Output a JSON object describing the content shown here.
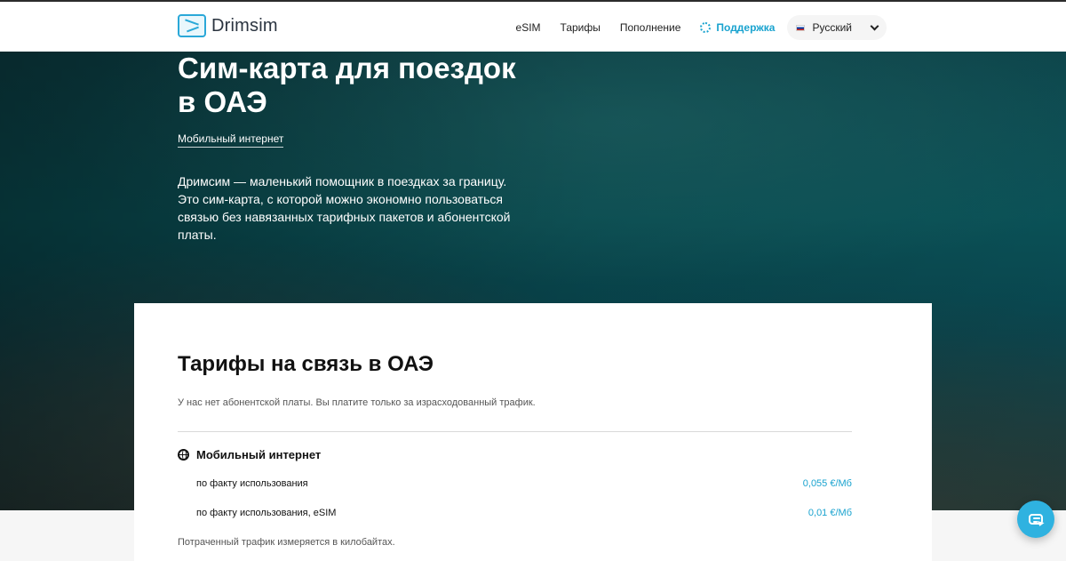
{
  "header": {
    "logo_text": "Drimsim",
    "nav": {
      "esim": "eSIM",
      "tariffs": "Тарифы",
      "topup": "Пополнение",
      "support": "Поддержка"
    },
    "language": {
      "label": "Русский"
    }
  },
  "hero": {
    "title_line1": "Сим-карта для поездок",
    "title_line2": "в ОАЭ",
    "link": "Мобильный интернет",
    "description": "Дримсим — маленький помощник в поездках за границу. Это сим-карта, с которой можно экономно пользоваться связью без навязанных тарифных пакетов и абонентской платы."
  },
  "rates": {
    "title": "Тарифы на связь в ОАЭ",
    "subtitle": "У нас нет абонентской платы. Вы платите только за израсходованный трафик.",
    "section_title": "Мобильный интернет",
    "rows": [
      {
        "label": "по факту использования",
        "price": "0,055 €/Мб"
      },
      {
        "label": "по факту использования, eSIM",
        "price": "0,01 €/Мб"
      }
    ],
    "footnote": "Потраченный трафик измеряется в килобайтах."
  },
  "colors": {
    "accent": "#1aa3cf",
    "chat_bubble": "#2fb2e0"
  },
  "icons": {
    "logo": "drimsim-logo-icon",
    "support": "support-icon",
    "language_flag": "ru-flag-icon",
    "dropdown": "chevron-down-icon",
    "section": "globe-icon",
    "chat": "chat-icon"
  }
}
